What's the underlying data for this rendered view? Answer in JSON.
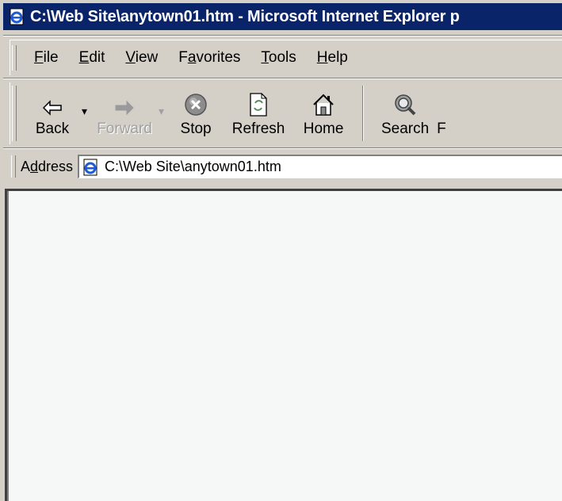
{
  "window": {
    "title": "C:\\Web Site\\anytown01.htm - Microsoft Internet Explorer p",
    "icon": "ie-page-icon"
  },
  "menubar": {
    "items": [
      {
        "label": "File",
        "access": "F"
      },
      {
        "label": "Edit",
        "access": "E"
      },
      {
        "label": "View",
        "access": "V"
      },
      {
        "label": "Favorites",
        "access": "a"
      },
      {
        "label": "Tools",
        "access": "T"
      },
      {
        "label": "Help",
        "access": "H"
      }
    ]
  },
  "toolbar": {
    "back_label": "Back",
    "forward_label": "Forward",
    "stop_label": "Stop",
    "refresh_label": "Refresh",
    "home_label": "Home",
    "search_label": "Search",
    "cut_label": "F",
    "icons": [
      "back-arrow-icon",
      "forward-arrow-icon",
      "stop-icon",
      "refresh-icon",
      "home-icon",
      "search-icon"
    ]
  },
  "addressbar": {
    "label": "Address",
    "url": "C:\\Web Site\\anytown01.htm"
  },
  "colors": {
    "titlebar": "#0a246a",
    "chrome": "#d4d0c8",
    "content_bg": "#f5f8f6"
  }
}
